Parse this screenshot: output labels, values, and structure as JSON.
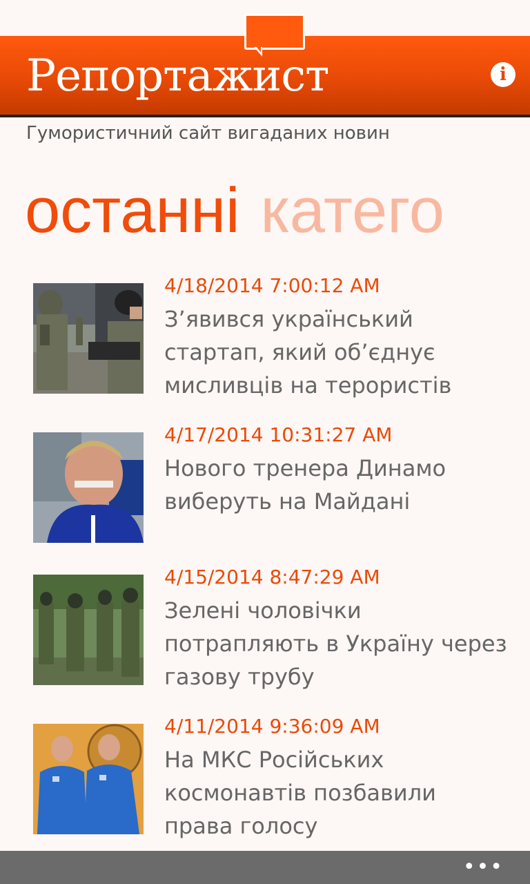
{
  "app": {
    "title": "Репортажист",
    "tagline": "Гумористичний сайт вигаданих новин",
    "info_glyph": "i",
    "accent": "#f04c0a"
  },
  "pivot": {
    "items": [
      {
        "label": "останні"
      },
      {
        "label": "катего"
      }
    ]
  },
  "news": [
    {
      "date": "4/18/2014 7:00:12 AM",
      "headline": "З’явився український стартап, який об’єднує мисливців на терористів"
    },
    {
      "date": "4/17/2014 10:31:27 AM",
      "headline": "Нового тренера Динамо виберуть на Майдані"
    },
    {
      "date": "4/15/2014 8:47:29 AM",
      "headline": "Зелені чоловічки потрапляють в Україну через газову трубу"
    },
    {
      "date": "4/11/2014 9:36:09 AM",
      "headline": "На МКС Російських космонавтів позбавили права голосу"
    }
  ],
  "appbar": {
    "more_glyph": "•••"
  }
}
